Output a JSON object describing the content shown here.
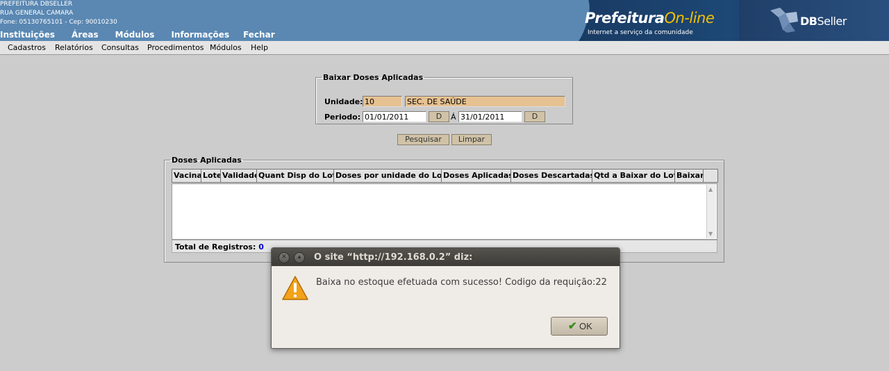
{
  "header": {
    "org_name": "PREFEITURA DBSELLER",
    "address": "RUA GENERAL CAMARA",
    "contact": "Fone: 05130765101  -  Cep: 90010230",
    "banner_title_1": "Prefeitura",
    "banner_title_2": "On-line",
    "banner_subtitle": "Internet a serviço da comunidade",
    "brand_bold": "DB",
    "brand_light": "Seller"
  },
  "top_menu": [
    "Instituições",
    "Áreas",
    "Módulos",
    "Informações",
    "Fechar"
  ],
  "sub_menu": [
    "Cadastros",
    "Relatórios",
    "Consultas",
    "Procedimentos",
    "Módulos",
    "Help"
  ],
  "form": {
    "legend": "Baixar Doses Aplicadas",
    "unidade_label": "Unidade:",
    "unidade_code": "10",
    "unidade_name": "SEC. DE SAÚDE",
    "periodo_label": "Periodo:",
    "date_start": "01/01/2011",
    "date_sep": "Á",
    "date_end": "31/01/2011",
    "date_btn": "D",
    "search_btn": "Pesquisar",
    "clear_btn": "Limpar"
  },
  "grid": {
    "legend": "Doses Aplicadas",
    "columns": [
      "Vacina",
      "Lote",
      "Validade",
      "Quant Disp do Lote",
      "Doses por unidade do Lote",
      "Doses Aplicadas",
      "Doses Descartadas",
      "Qtd a Baixar do Lote",
      "Baixar"
    ],
    "total_label": "Total de Registros:",
    "total_value": "0"
  },
  "dialog": {
    "title": "O site “http://192.168.0.2” diz:",
    "message": "Baixa no estoque efetuada com sucesso! Codigo da requição:22",
    "ok_label": "OK",
    "icon": "warning-icon"
  }
}
